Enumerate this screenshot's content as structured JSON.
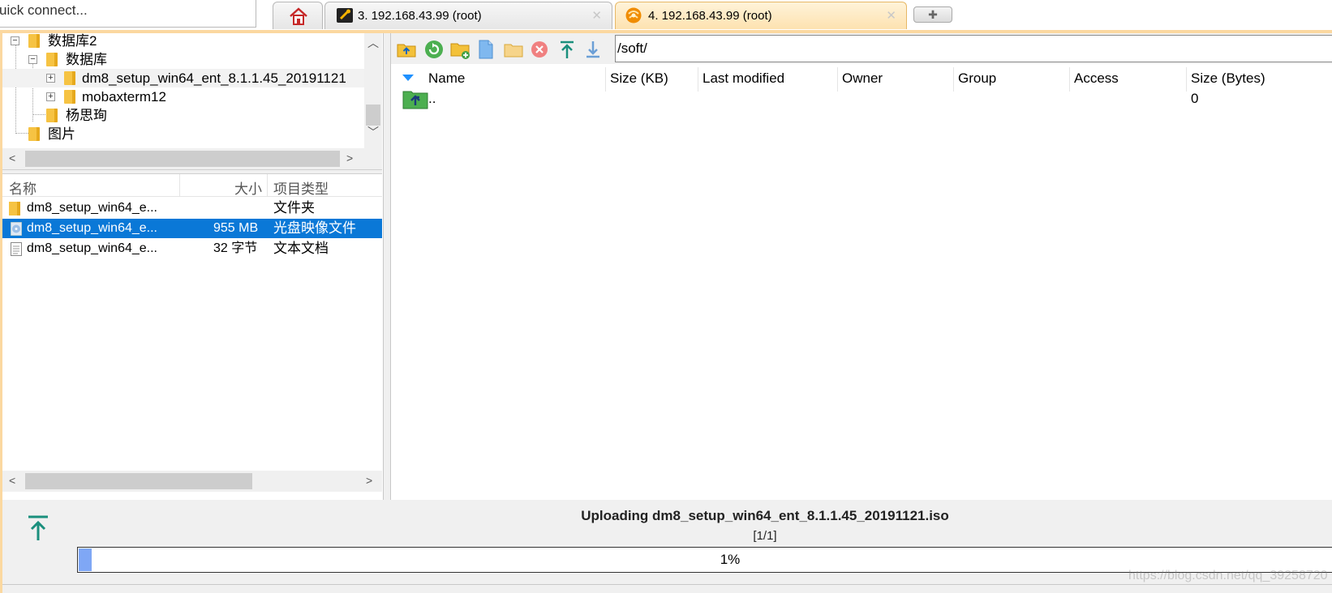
{
  "quick_connect": {
    "text": "uick connect..."
  },
  "tabs": [
    {
      "label": "",
      "icon": "home-icon"
    },
    {
      "label": "3. 192.168.43.99 (root)",
      "icon": "terminal-icon",
      "close": "✕"
    },
    {
      "label": "4. 192.168.43.99 (root)",
      "icon": "sftp-icon",
      "close": "✕",
      "active": true
    }
  ],
  "add_tab": {
    "label": "✚"
  },
  "folder_tree": {
    "items": [
      {
        "label": "数据库2"
      },
      {
        "label": "数据库"
      },
      {
        "label": "dm8_setup_win64_ent_8.1.1.45_20191121"
      },
      {
        "label": "mobaxterm12"
      },
      {
        "label": "杨思珣"
      },
      {
        "label": "图片"
      }
    ]
  },
  "local_files": {
    "headers": {
      "name": "名称",
      "size": "大小",
      "type": "项目类型"
    },
    "rows": [
      {
        "name": "dm8_setup_win64_e...",
        "size": "",
        "type": "文件夹",
        "icon": "folder-icon"
      },
      {
        "name": "dm8_setup_win64_e...",
        "size": "955 MB",
        "type": "光盘映像文件",
        "icon": "disc-image-icon",
        "selected": true
      },
      {
        "name": "dm8_setup_win64_e...",
        "size": "32 字节",
        "type": "文本文档",
        "icon": "text-file-icon"
      }
    ]
  },
  "remote": {
    "path": "/soft/",
    "columns": [
      "Name",
      "Size (KB)",
      "Last modified",
      "Owner",
      "Group",
      "Access",
      "Size (Bytes)"
    ],
    "rows": [
      {
        "name": "..",
        "size_bytes": "0",
        "icon": "parent-folder-icon"
      }
    ]
  },
  "transfer": {
    "title": "Uploading dm8_setup_win64_ent_8.1.1.45_20191121.iso",
    "count": "[1/1]",
    "progress_label": "1%",
    "progress": 0.01
  },
  "watermark": "https://blog.csdn.net/qq_39258720",
  "colors": {
    "accent_orange": "#fbd8a0",
    "selection_blue": "#0a78d7",
    "progress_fill": "#7fa7f5"
  }
}
